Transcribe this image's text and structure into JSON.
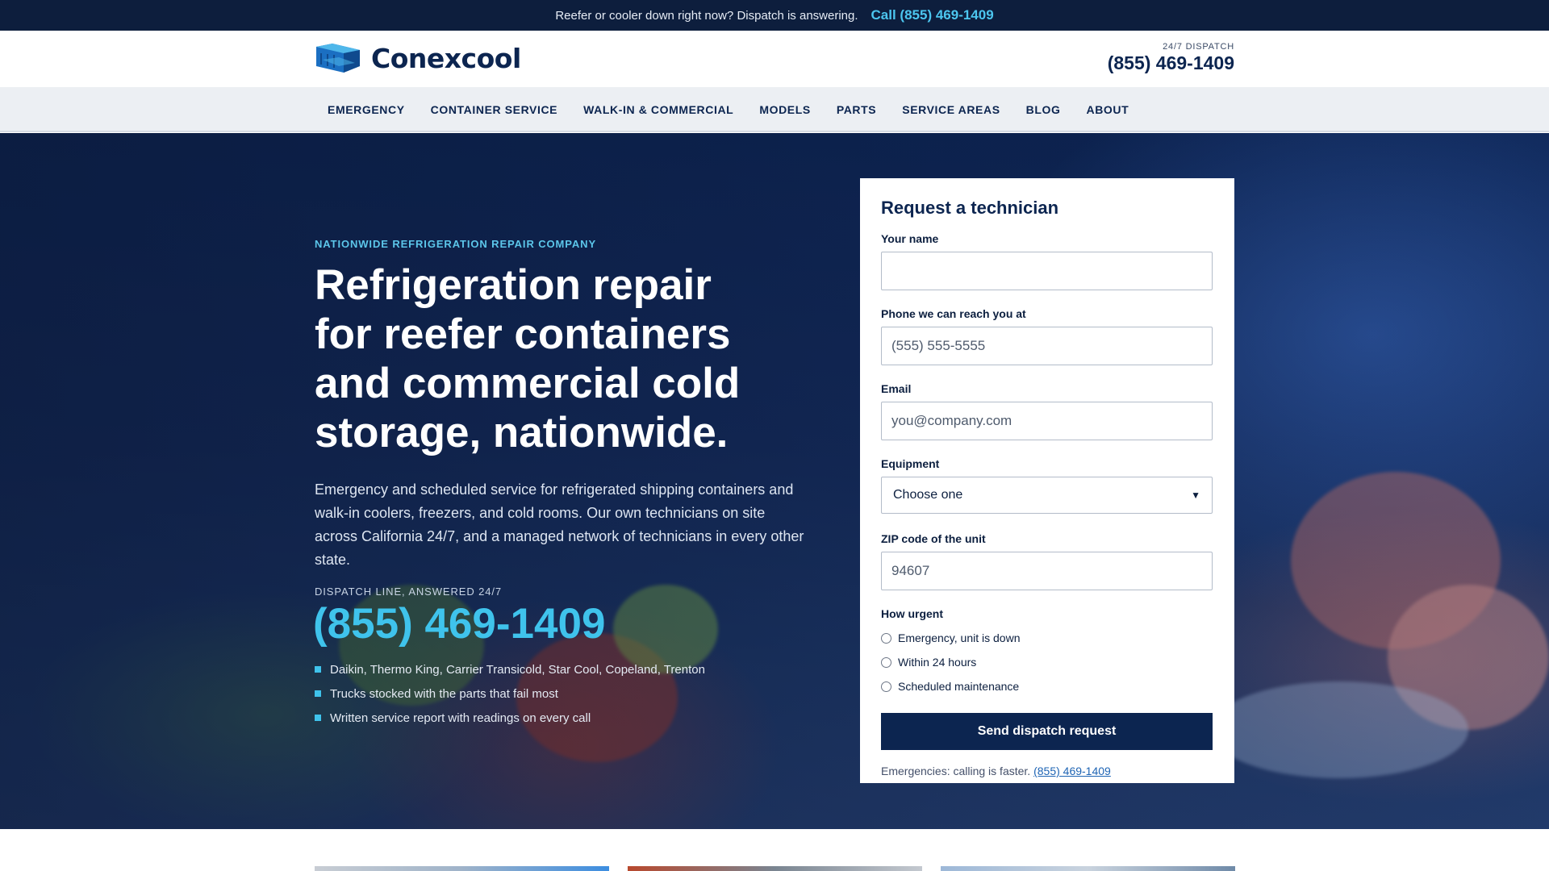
{
  "topbar": {
    "message": "Reefer or cooler down right now? Dispatch is answering.",
    "call_label": "Call (855) 469-1409"
  },
  "header": {
    "brand": "Conexcool",
    "dispatch_label": "24/7 DISPATCH",
    "dispatch_number": "(855) 469-1409"
  },
  "nav": {
    "items": [
      "EMERGENCY",
      "CONTAINER SERVICE",
      "WALK-IN & COMMERCIAL",
      "MODELS",
      "PARTS",
      "SERVICE AREAS",
      "BLOG",
      "ABOUT"
    ]
  },
  "hero": {
    "eyebrow": "NATIONWIDE REFRIGERATION REPAIR COMPANY",
    "headline": "Refrigeration repair for reefer containers and commercial cold storage, nationwide.",
    "lead": "Emergency and scheduled service for refrigerated shipping containers and walk-in coolers, freezers, and cold rooms. Our own technicians on site across California 24/7, and a managed network of technicians in every other state.",
    "dispatch_label": "DISPATCH LINE, ANSWERED 24/7",
    "dispatch_number": "(855) 469-1409",
    "bullets": [
      "Daikin, Thermo King, Carrier Transicold, Star Cool, Copeland, Trenton",
      "Trucks stocked with the parts that fail most",
      "Written service report with readings on every call"
    ]
  },
  "form": {
    "title": "Request a technician",
    "name_label": "Your name",
    "name_value": "",
    "phone_label": "Phone we can reach you at",
    "phone_placeholder": "(555) 555-5555",
    "email_label": "Email",
    "email_placeholder": "you@company.com",
    "equipment_label": "Equipment",
    "equipment_selected": "Choose one",
    "zip_label": "ZIP code of the unit",
    "zip_placeholder": "94607",
    "urgency_label": "How urgent",
    "urgency_options": [
      "Emergency, unit is down",
      "Within 24 hours",
      "Scheduled maintenance"
    ],
    "submit_label": "Send dispatch request",
    "footnote_text": "Emergencies: calling is faster.",
    "footnote_link": "(855) 469-1409"
  },
  "colors": {
    "navy": "#0c2550",
    "accent_cyan": "#3fc3ec",
    "topbar_bg": "#0d1e3d",
    "nav_bg": "#eceff3"
  }
}
